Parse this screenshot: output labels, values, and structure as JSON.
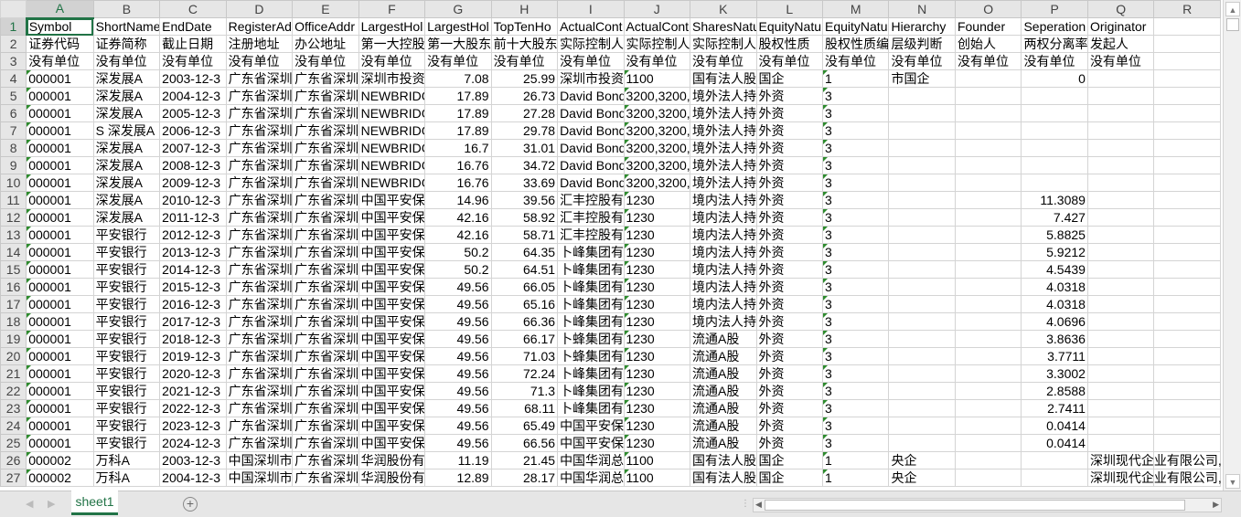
{
  "columns": [
    "A",
    "B",
    "C",
    "D",
    "E",
    "F",
    "G",
    "H",
    "I",
    "J",
    "K",
    "L",
    "M",
    "N",
    "O",
    "P",
    "Q",
    "R"
  ],
  "active_cell": "A1",
  "sheet_tab": "sheet1",
  "add_sheet_icon": "plus-circle-icon",
  "rows": [
    [
      "Symbol",
      "ShortName",
      "EndDate",
      "RegisterAd",
      "OfficeAddr",
      "LargestHol",
      "LargestHol",
      "TopTenHo",
      "ActualCont",
      "ActualCont",
      "SharesNatu",
      "EquityNatu",
      "EquityNatu",
      "Hierarchy",
      "Founder",
      "Seperation",
      "Originator",
      ""
    ],
    [
      "证券代码",
      "证券简称",
      "截止日期",
      "注册地址",
      "办公地址",
      "第一大控股",
      "第一大股东",
      "前十大股东",
      "实际控制人",
      "实际控制人",
      "实际控制人",
      "股权性质",
      "股权性质编",
      "层级判断",
      "创始人",
      "两权分离率",
      "发起人",
      ""
    ],
    [
      "没有单位",
      "没有单位",
      "没有单位",
      "没有单位",
      "没有单位",
      "没有单位",
      "没有单位",
      "没有单位",
      "没有单位",
      "没有单位",
      "没有单位",
      "没有单位",
      "没有单位",
      "没有单位",
      "没有单位",
      "没有单位",
      "没有单位",
      ""
    ],
    [
      "000001",
      "深发展A",
      "2003-12-3",
      "广东省深圳",
      "广东省深圳",
      "深圳市投资",
      "7.08",
      "25.99",
      "深圳市投资",
      "1100",
      "国有法人股",
      "国企",
      "1",
      "市国企",
      "",
      "0",
      "",
      ""
    ],
    [
      "000001",
      "深发展A",
      "2004-12-3",
      "广东省深圳",
      "广东省深圳",
      "NEWBRIDG",
      "17.89",
      "26.73",
      "David Bond",
      "3200,3200,",
      "境外法人持",
      "外资",
      "3",
      "",
      "",
      "",
      "",
      ""
    ],
    [
      "000001",
      "深发展A",
      "2005-12-3",
      "广东省深圳",
      "广东省深圳",
      "NEWBRIDG",
      "17.89",
      "27.28",
      "David Bond",
      "3200,3200,",
      "境外法人持",
      "外资",
      "3",
      "",
      "",
      "",
      "",
      ""
    ],
    [
      "000001",
      "S 深发展A",
      "2006-12-3",
      "广东省深圳",
      "广东省深圳",
      "NEWBRIDG",
      "17.89",
      "29.78",
      "David Bond",
      "3200,3200,",
      "境外法人持",
      "外资",
      "3",
      "",
      "",
      "",
      "",
      ""
    ],
    [
      "000001",
      "深发展A",
      "2007-12-3",
      "广东省深圳",
      "广东省深圳",
      "NEWBRIDG",
      "16.7",
      "31.01",
      "David Bond",
      "3200,3200,",
      "境外法人持",
      "外资",
      "3",
      "",
      "",
      "",
      "",
      ""
    ],
    [
      "000001",
      "深发展A",
      "2008-12-3",
      "广东省深圳",
      "广东省深圳",
      "NEWBRIDG",
      "16.76",
      "34.72",
      "David Bond",
      "3200,3200,",
      "境外法人持",
      "外资",
      "3",
      "",
      "",
      "",
      "",
      ""
    ],
    [
      "000001",
      "深发展A",
      "2009-12-3",
      "广东省深圳",
      "广东省深圳",
      "NEWBRIDG",
      "16.76",
      "33.69",
      "David Bond",
      "3200,3200,",
      "境外法人持",
      "外资",
      "3",
      "",
      "",
      "",
      "",
      ""
    ],
    [
      "000001",
      "深发展A",
      "2010-12-3",
      "广东省深圳",
      "广东省深圳",
      "中国平安保",
      "14.96",
      "39.56",
      "汇丰控股有",
      "1230",
      "境内法人持",
      "外资",
      "3",
      "",
      "",
      "11.3089",
      "",
      ""
    ],
    [
      "000001",
      "深发展A",
      "2011-12-3",
      "广东省深圳",
      "广东省深圳",
      "中国平安保",
      "42.16",
      "58.92",
      "汇丰控股有",
      "1230",
      "境内法人持",
      "外资",
      "3",
      "",
      "",
      "7.427",
      "",
      ""
    ],
    [
      "000001",
      "平安银行",
      "2012-12-3",
      "广东省深圳",
      "广东省深圳",
      "中国平安保",
      "42.16",
      "58.71",
      "汇丰控股有",
      "1230",
      "境内法人持",
      "外资",
      "3",
      "",
      "",
      "5.8825",
      "",
      ""
    ],
    [
      "000001",
      "平安银行",
      "2013-12-3",
      "广东省深圳",
      "广东省深圳",
      "中国平安保",
      "50.2",
      "64.35",
      "卜峰集团有",
      "1230",
      "境内法人持",
      "外资",
      "3",
      "",
      "",
      "5.9212",
      "",
      ""
    ],
    [
      "000001",
      "平安银行",
      "2014-12-3",
      "广东省深圳",
      "广东省深圳",
      "中国平安保",
      "50.2",
      "64.51",
      "卜峰集团有",
      "1230",
      "境内法人持",
      "外资",
      "3",
      "",
      "",
      "4.5439",
      "",
      ""
    ],
    [
      "000001",
      "平安银行",
      "2015-12-3",
      "广东省深圳",
      "广东省深圳",
      "中国平安保",
      "49.56",
      "66.05",
      "卜峰集团有",
      "1230",
      "境内法人持",
      "外资",
      "3",
      "",
      "",
      "4.0318",
      "",
      ""
    ],
    [
      "000001",
      "平安银行",
      "2016-12-3",
      "广东省深圳",
      "广东省深圳",
      "中国平安保",
      "49.56",
      "65.16",
      "卜峰集团有",
      "1230",
      "境内法人持",
      "外资",
      "3",
      "",
      "",
      "4.0318",
      "",
      ""
    ],
    [
      "000001",
      "平安银行",
      "2017-12-3",
      "广东省深圳",
      "广东省深圳",
      "中国平安保",
      "49.56",
      "66.36",
      "卜峰集团有",
      "1230",
      "境内法人持",
      "外资",
      "3",
      "",
      "",
      "4.0696",
      "",
      ""
    ],
    [
      "000001",
      "平安银行",
      "2018-12-3",
      "广东省深圳",
      "广东省深圳",
      "中国平安保",
      "49.56",
      "66.17",
      "卜蜂集团有",
      "1230",
      "流通A股",
      "外资",
      "3",
      "",
      "",
      "3.8636",
      "",
      ""
    ],
    [
      "000001",
      "平安银行",
      "2019-12-3",
      "广东省深圳",
      "广东省深圳",
      "中国平安保",
      "49.56",
      "71.03",
      "卜蜂集团有",
      "1230",
      "流通A股",
      "外资",
      "3",
      "",
      "",
      "3.7711",
      "",
      ""
    ],
    [
      "000001",
      "平安银行",
      "2020-12-3",
      "广东省深圳",
      "广东省深圳",
      "中国平安保",
      "49.56",
      "72.24",
      "卜峰集团有",
      "1230",
      "流通A股",
      "外资",
      "3",
      "",
      "",
      "3.3002",
      "",
      ""
    ],
    [
      "000001",
      "平安银行",
      "2021-12-3",
      "广东省深圳",
      "广东省深圳",
      "中国平安保",
      "49.56",
      "71.3",
      "卜峰集团有",
      "1230",
      "流通A股",
      "外资",
      "3",
      "",
      "",
      "2.8588",
      "",
      ""
    ],
    [
      "000001",
      "平安银行",
      "2022-12-3",
      "广东省深圳",
      "广东省深圳",
      "中国平安保",
      "49.56",
      "68.11",
      "卜峰集团有",
      "1230",
      "流通A股",
      "外资",
      "3",
      "",
      "",
      "2.7411",
      "",
      ""
    ],
    [
      "000001",
      "平安银行",
      "2023-12-3",
      "广东省深圳",
      "广东省深圳",
      "中国平安保",
      "49.56",
      "65.49",
      "中国平安保",
      "1230",
      "流通A股",
      "外资",
      "3",
      "",
      "",
      "0.0414",
      "",
      ""
    ],
    [
      "000001",
      "平安银行",
      "2024-12-3",
      "广东省深圳",
      "广东省深圳",
      "中国平安保",
      "49.56",
      "66.56",
      "中国平安保",
      "1230",
      "流通A股",
      "外资",
      "3",
      "",
      "",
      "0.0414",
      "",
      ""
    ],
    [
      "000002",
      "万科A",
      "2003-12-3",
      "中国深圳市",
      "广东省深圳",
      "华润股份有",
      "11.19",
      "21.45",
      "中国华润总",
      "1100",
      "国有法人股",
      "国企",
      "1",
      "央企",
      "",
      "",
      "深圳现代企业有限公司,",
      ""
    ],
    [
      "000002",
      "万科A",
      "2004-12-3",
      "中国深圳市",
      "广东省深圳",
      "华润股份有",
      "12.89",
      "28.17",
      "中国华润总",
      "1100",
      "国有法人股",
      "国企",
      "1",
      "央企",
      "",
      "",
      "深圳现代企业有限公司,",
      ""
    ]
  ]
}
